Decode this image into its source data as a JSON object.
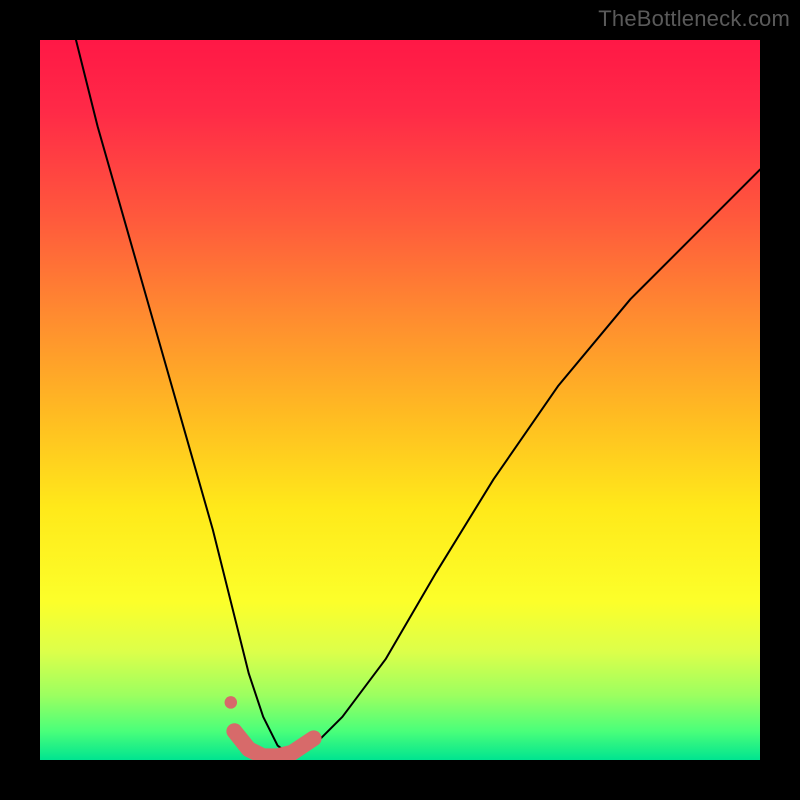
{
  "watermark": "TheBottleneck.com",
  "chart_data": {
    "type": "line",
    "title": "",
    "xlabel": "",
    "ylabel": "",
    "xlim": [
      0,
      100
    ],
    "ylim": [
      0,
      100
    ],
    "grid": false,
    "legend": false,
    "background_gradient": {
      "top": "#ff1846",
      "mid": "#ffe91a",
      "bottom": "#00e490"
    },
    "series": [
      {
        "name": "bottleneck-curve",
        "color": "#000000",
        "weight": 2,
        "x": [
          5,
          8,
          12,
          16,
          20,
          24,
          27,
          29,
          31,
          33,
          35,
          38,
          42,
          48,
          55,
          63,
          72,
          82,
          92,
          100
        ],
        "y": [
          100,
          88,
          74,
          60,
          46,
          32,
          20,
          12,
          6,
          2,
          0.5,
          2,
          6,
          14,
          26,
          39,
          52,
          64,
          74,
          82
        ]
      },
      {
        "name": "highlight-band",
        "color": "#d76a6a",
        "weight": 16,
        "x": [
          27,
          29,
          31,
          33,
          35,
          38
        ],
        "y": [
          4,
          1.5,
          0.5,
          0.5,
          1,
          3
        ]
      },
      {
        "name": "highlight-dot",
        "color": "#d76a6a",
        "weight": 10,
        "x": [
          26.5
        ],
        "y": [
          8
        ]
      }
    ],
    "notes": "Axes are unlabeled in the source image; x and y are normalized 0–100. Curve depicts a sharp V with minimum near x≈34, y≈0; right arm rises more gradually than the left. A thick salmon segment traces the bottom of the V with a small detached dot above the start of that segment."
  }
}
